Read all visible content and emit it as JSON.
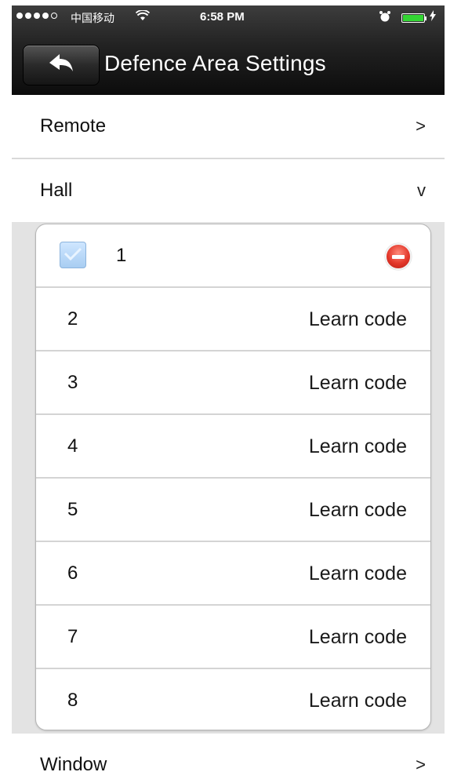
{
  "status_bar": {
    "carrier": "中国移动",
    "time": "6:58 PM"
  },
  "nav": {
    "title": "Defence Area Settings"
  },
  "sections": [
    {
      "label": "Remote",
      "indicator": ">"
    },
    {
      "label": "Hall",
      "indicator": "v"
    },
    {
      "label": "Window",
      "indicator": ">"
    }
  ],
  "zones": [
    {
      "number": "1",
      "checked": true,
      "action": ""
    },
    {
      "number": "2",
      "action": "Learn code"
    },
    {
      "number": "3",
      "action": "Learn code"
    },
    {
      "number": "4",
      "action": "Learn code"
    },
    {
      "number": "5",
      "action": "Learn code"
    },
    {
      "number": "6",
      "action": "Learn code"
    },
    {
      "number": "7",
      "action": "Learn code"
    },
    {
      "number": "8",
      "action": "Learn code"
    }
  ],
  "colors": {
    "nav_bg": "#1a1a1a",
    "delete_red": "#e3372a",
    "checkbox_blue": "#a8cdf2",
    "battery_green": "#33d633"
  },
  "icons": {
    "back": "back-arrow-icon",
    "delete": "minus-circle-icon",
    "checkbox": "checkmark-icon"
  }
}
